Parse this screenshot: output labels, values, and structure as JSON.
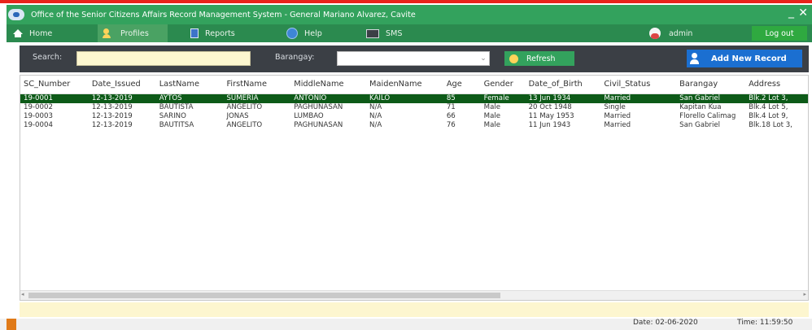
{
  "window": {
    "title": "Office of the Senior Citizens Affairs Record Management System - General Mariano Alvarez, Cavite",
    "min_glyph": "_",
    "close_glyph": "✕"
  },
  "menu": {
    "home": "Home",
    "profiles": "Profiles",
    "reports": "Reports",
    "help": "Help",
    "sms": "SMS",
    "user": "admin",
    "logout": "Log out"
  },
  "toolbar": {
    "search_label": "Search:",
    "search_value": "",
    "barangay_label": "Barangay:",
    "barangay_value": "",
    "refresh_label": "Refresh",
    "add_label": "Add New Record"
  },
  "table": {
    "headers": [
      "SC_Number",
      "Date_Issued",
      "LastName",
      "FirstName",
      "MiddleName",
      "MaidenName",
      "Age",
      "Gender",
      "Date_of_Birth",
      "Civil_Status",
      "Barangay",
      "Address"
    ],
    "rows": [
      [
        "19-0001",
        "12-13-2019",
        "AYTOS",
        "SUMERIA",
        "ANTONIO",
        "KAILO",
        "85",
        "Female",
        "13 Jun 1934",
        "Married",
        "San Gabriel",
        "Blk.2 Lot 3,"
      ],
      [
        "19-0002",
        "12-13-2019",
        "BAUTISTA",
        "ANGELITO",
        "PAGHUNASAN",
        "N/A",
        "71",
        "Male",
        "20 Oct 1948",
        "Single",
        "Kapitan Kua",
        "Blk.4 Lot 5,"
      ],
      [
        "19-0003",
        "12-13-2019",
        "SARINO",
        "JONAS",
        "LUMBAO",
        "N/A",
        "66",
        "Male",
        "11 May 1953",
        "Married",
        "Florello Calimag",
        "Blk.4 Lot 9,"
      ],
      [
        "19-0004",
        "12-13-2019",
        "BAUTITSA",
        "ANGELITO",
        "PAGHUNASAN",
        "N/A",
        "76",
        "Male",
        "11 Jun 1943",
        "Married",
        "San Gabriel",
        "Blk.18 Lot 3,"
      ]
    ]
  },
  "status": {
    "date": "Date: 02-06-2020",
    "time": "Time: 11:59:50"
  },
  "colors": {
    "titlebar": "#33a25d",
    "menubar": "#2b8a4f",
    "selected_row": "#0d5a18",
    "add_button": "#1b6fd1"
  }
}
